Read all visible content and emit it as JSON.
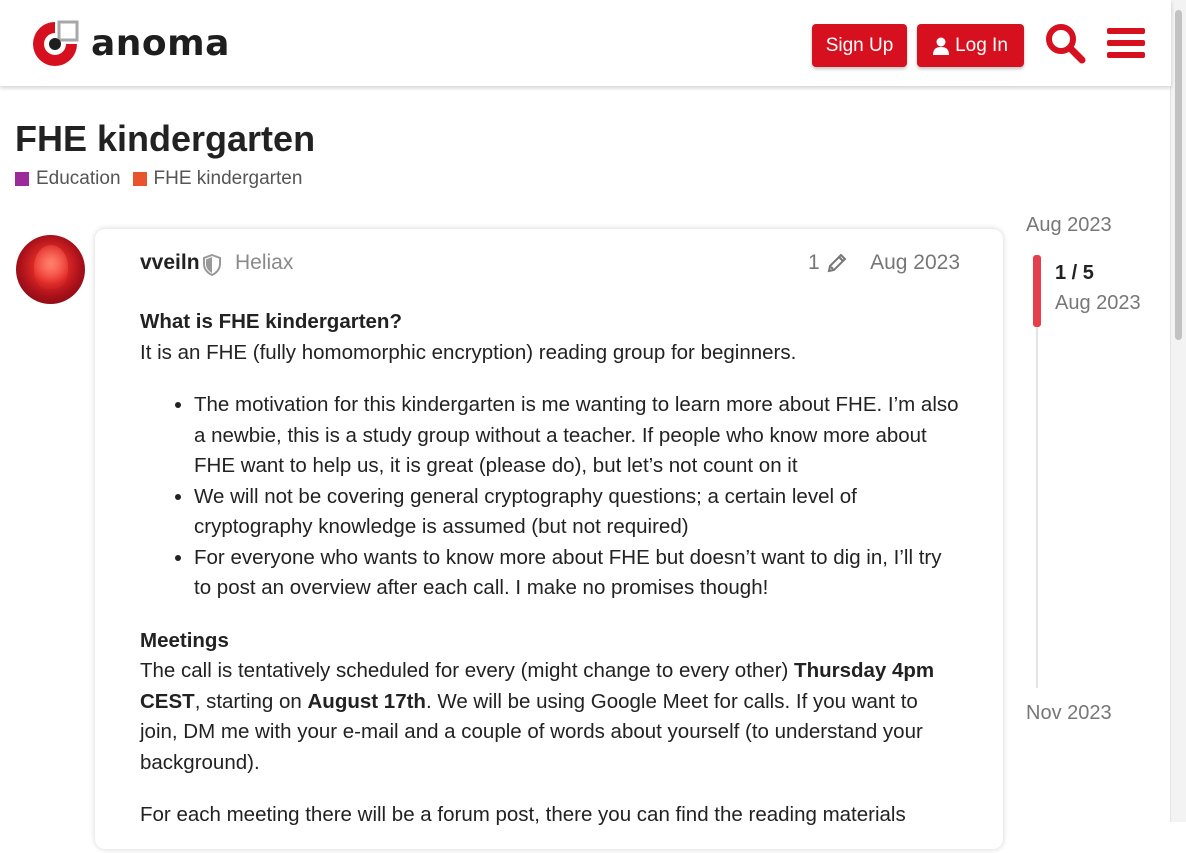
{
  "header": {
    "logo_text": "anoma",
    "signup_label": "Sign Up",
    "login_label": "Log In",
    "accent_color": "#d6101e"
  },
  "topic": {
    "title": "FHE kindergarten",
    "categories": [
      {
        "label": "Education",
        "color": "#9b2a9b"
      },
      {
        "label": "FHE kindergarten",
        "color": "#e8542c"
      }
    ]
  },
  "post": {
    "username": "vveiln",
    "group": "Heliax",
    "edit_count": "1",
    "date": "Aug 2023",
    "heading1": "What is FHE kindergarten?",
    "intro": "It is an FHE (fully homomorphic encryption) reading group for beginners.",
    "bullets": [
      "The motivation for this kindergarten is me wanting to learn more about FHE. I’m also a newbie, this is a study group without a teacher. If people who know more about FHE want to help us, it is great (please do), but let’s not count on it",
      "We will not be covering general cryptography questions; a certain level of cryptography knowledge is assumed (but not required)",
      "For everyone who wants to know more about FHE but doesn’t want to dig in, I’ll try to post an overview after each call. I make no promises though!"
    ],
    "heading2": "Meetings",
    "meet_1": "The call is tentatively scheduled for every (might change to every other) ",
    "meet_time": "Thursday 4pm CEST",
    "meet_2": ", starting on ",
    "meet_date": "August 17th",
    "meet_3": ". We will be using Google Meet for calls. If you want to join, DM me with your e-mail and a couple of words about yourself (to understand your background).",
    "next_para": "For each meeting there will be a forum post, there you can find the reading materials"
  },
  "timeline": {
    "start_date": "Aug 2023",
    "position": "1 / 5",
    "position_date": "Aug 2023",
    "end_date": "Nov 2023"
  }
}
